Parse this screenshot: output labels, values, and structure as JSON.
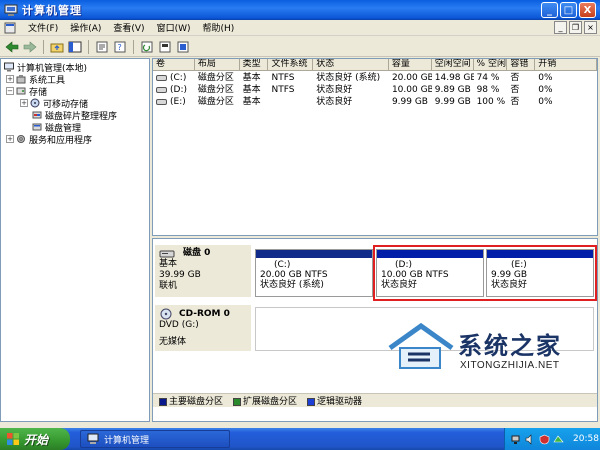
{
  "window": {
    "title": "计算机管理"
  },
  "menu": {
    "items": [
      "文件(F)",
      "操作(A)",
      "查看(V)",
      "窗口(W)",
      "帮助(H)"
    ]
  },
  "window_controls": {
    "minimize": "_",
    "maximize": "□",
    "close": "X"
  },
  "mdi_controls": {
    "minimize": "_",
    "restore": "❐",
    "close": "×"
  },
  "toolbar": {
    "icons": [
      "back-arrow-icon",
      "forward-arrow-icon",
      "up-folder-icon",
      "show-tree-icon",
      "properties-icon",
      "help-icon",
      "refresh-icon",
      "export-icon",
      "properties2-icon"
    ]
  },
  "tree": {
    "items": [
      {
        "label": "计算机管理(本地)",
        "level": 0
      },
      {
        "label": "系统工具",
        "level": 1,
        "expander": "+"
      },
      {
        "label": "存储",
        "level": 1,
        "expander": "−"
      },
      {
        "label": "可移动存储",
        "level": 2,
        "expander": "+"
      },
      {
        "label": "磁盘碎片整理程序",
        "level": 2
      },
      {
        "label": "磁盘管理",
        "level": 2
      },
      {
        "label": "服务和应用程序",
        "level": 1,
        "expander": "+"
      }
    ]
  },
  "volumes": {
    "columns": [
      "卷",
      "布局",
      "类型",
      "文件系统",
      "状态",
      "容量",
      "空闲空间",
      "% 空闲",
      "容错",
      "开销"
    ],
    "rows": [
      [
        "(C:)",
        "磁盘分区",
        "基本",
        "NTFS",
        "状态良好 (系统)",
        "20.00 GB",
        "14.98 GB",
        "74 %",
        "否",
        "0%"
      ],
      [
        "(D:)",
        "磁盘分区",
        "基本",
        "NTFS",
        "状态良好",
        "10.00 GB",
        "9.89 GB",
        "98 %",
        "否",
        "0%"
      ],
      [
        "(E:)",
        "磁盘分区",
        "基本",
        "",
        "状态良好",
        "9.99 GB",
        "9.99 GB",
        "100 %",
        "否",
        "0%"
      ]
    ]
  },
  "disk0": {
    "name": "磁盘 0",
    "type": "基本",
    "size": "39.99 GB",
    "status": "联机",
    "partitions": [
      {
        "name": "(C:)",
        "detail": "20.00 GB NTFS",
        "status": "状态良好 (系统)"
      },
      {
        "name": "(D:)",
        "detail": "10.00 GB NTFS",
        "status": "状态良好"
      },
      {
        "name": "(E:)",
        "detail": "9.99 GB",
        "status": "状态良好"
      }
    ]
  },
  "cdrom0": {
    "name": "CD-ROM 0",
    "drive": "DVD (G:)",
    "status": "无媒体"
  },
  "legend": {
    "items": [
      {
        "label": "主要磁盘分区",
        "color": "#0a1a8c"
      },
      {
        "label": "扩展磁盘分区",
        "color": "#2b8a2b"
      },
      {
        "label": "逻辑驱动器",
        "color": "#1e3fd6"
      }
    ]
  },
  "watermark": {
    "cn": "系统之家",
    "en": "XITONGZHIJIA.NET"
  },
  "taskbar": {
    "start_label": "开始",
    "task_label": "计算机管理",
    "clock": "20:58"
  },
  "colors": {
    "titlebar": "#0a5fe0",
    "primary_partition": "#102b8a",
    "logical_drive": "#001ea8",
    "highlight": "#e02020"
  }
}
